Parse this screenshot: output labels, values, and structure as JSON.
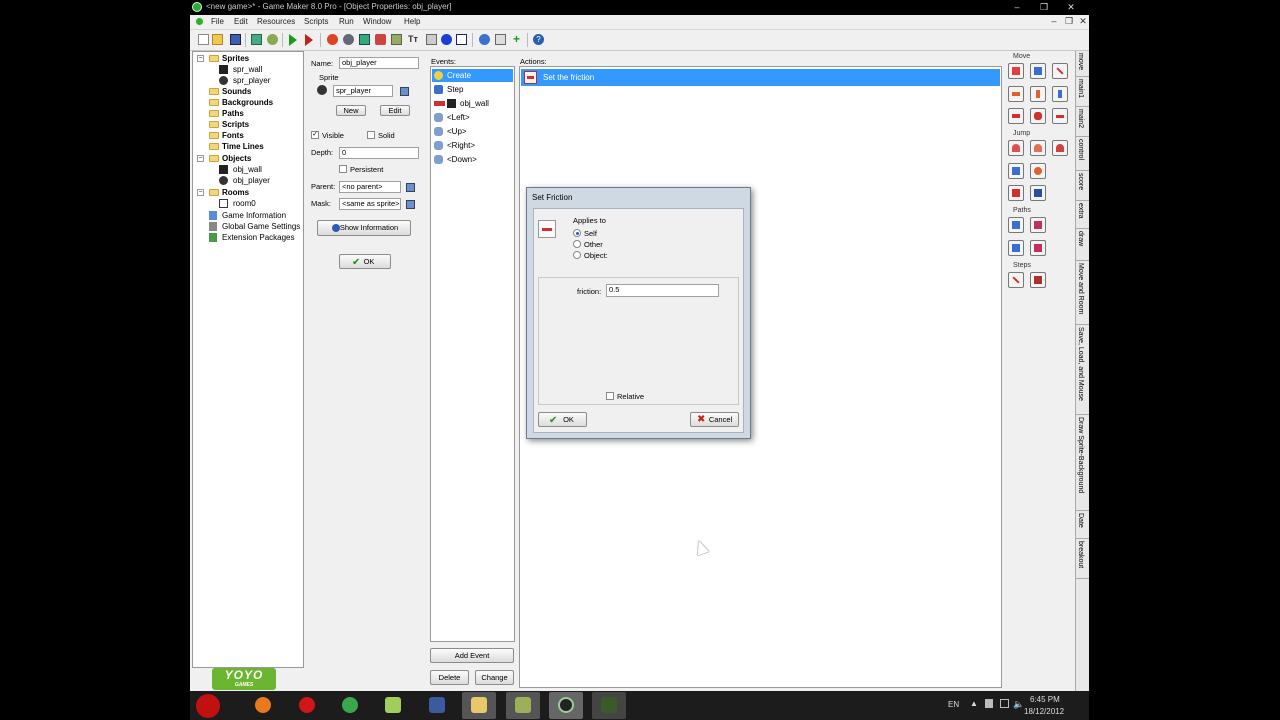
{
  "window": {
    "title": "<new game>* - Game Maker 8.0 Pro - [Object Properties: obj_player]"
  },
  "menu": [
    "File",
    "Edit",
    "Resources",
    "Scripts",
    "Run",
    "Window",
    "Help"
  ],
  "tree": {
    "sprites": "Sprites",
    "spr_wall": "spr_wall",
    "spr_player": "spr_player",
    "sounds": "Sounds",
    "backgrounds": "Backgrounds",
    "paths": "Paths",
    "scripts": "Scripts",
    "fonts": "Fonts",
    "timelines": "Time Lines",
    "objects": "Objects",
    "obj_wall": "obj_wall",
    "obj_player": "obj_player",
    "rooms": "Rooms",
    "room0": "room0",
    "game_info": "Game Information",
    "global_settings": "Global Game Settings",
    "extensions": "Extension Packages"
  },
  "logo": {
    "text": "YOYO",
    "sub": "GAMES"
  },
  "props": {
    "name_label": "Name:",
    "name_value": "obj_player",
    "sprite_label": "Sprite",
    "sprite_value": "spr_player",
    "new_btn": "New",
    "edit_btn": "Edit",
    "visible_label": "Visible",
    "solid_label": "Solid",
    "depth_label": "Depth:",
    "depth_value": "0",
    "persistent_label": "Persistent",
    "parent_label": "Parent:",
    "parent_value": "<no parent>",
    "mask_label": "Mask:",
    "mask_value": "<same as sprite>",
    "show_info_btn": "Show Information",
    "ok_btn": "OK"
  },
  "events": {
    "header": "Events:",
    "items": [
      "Create",
      "Step",
      "obj_wall",
      "<Left>",
      "<Up>",
      "<Right>",
      "<Down>"
    ],
    "add_btn": "Add Event",
    "delete_btn": "Delete",
    "change_btn": "Change"
  },
  "actions": {
    "header": "Actions:",
    "items": [
      "Set the friction"
    ]
  },
  "library": {
    "move": "Move",
    "jump": "Jump",
    "paths": "Paths",
    "steps": "Steps",
    "tabs": [
      "move",
      "main1",
      "main2",
      "control",
      "score",
      "extra",
      "draw",
      "Move and Room",
      "Save, Load, and Mouse",
      "Draw Sprite-Background",
      "Date",
      "breakout"
    ]
  },
  "dialog": {
    "title": "Set Friction",
    "applies_to": "Applies to",
    "opt_self": "Self",
    "opt_other": "Other",
    "opt_object": "Object:",
    "friction_label": "friction:",
    "friction_value": "0.5",
    "relative_label": "Relative",
    "ok": "OK",
    "cancel": "Cancel"
  },
  "taskbar": {
    "lang": "EN",
    "time": "6:45 PM",
    "date": "18/12/2012"
  }
}
